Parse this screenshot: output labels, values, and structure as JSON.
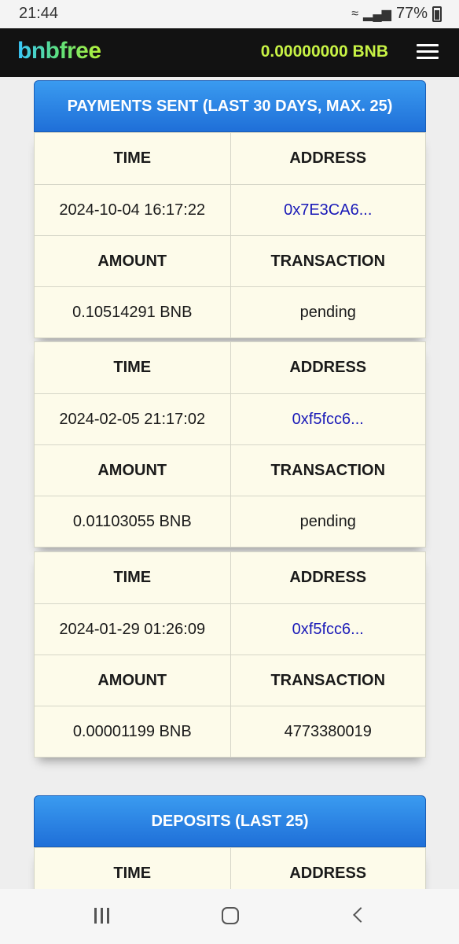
{
  "status_bar": {
    "time": "21:44",
    "battery": "77%"
  },
  "header": {
    "logo": "bnbfree",
    "balance": "0.00000000 BNB"
  },
  "payments": {
    "title": "PAYMENTS SENT (LAST 30 DAYS, MAX. 25)",
    "col_time": "TIME",
    "col_address": "ADDRESS",
    "col_amount": "AMOUNT",
    "col_transaction": "TRANSACTION",
    "rows": [
      {
        "time": "2024-10-04 16:17:22",
        "address": "0x7E3CA6...",
        "amount": "0.10514291 BNB",
        "transaction": "pending"
      },
      {
        "time": "2024-02-05 21:17:02",
        "address": "0xf5fcc6...",
        "amount": "0.01103055 BNB",
        "transaction": "pending"
      },
      {
        "time": "2024-01-29 01:26:09",
        "address": "0xf5fcc6...",
        "amount": "0.00001199 BNB",
        "transaction": "4773380019"
      }
    ]
  },
  "deposits": {
    "title": "DEPOSITS (LAST 25)",
    "col_time": "TIME",
    "col_address": "ADDRESS"
  },
  "colors": {
    "header_bg": "#121212",
    "balance": "#c7f245",
    "section_header": "#1f6fd8",
    "card_bg": "#fdfbea",
    "link": "#1a1ab8"
  }
}
